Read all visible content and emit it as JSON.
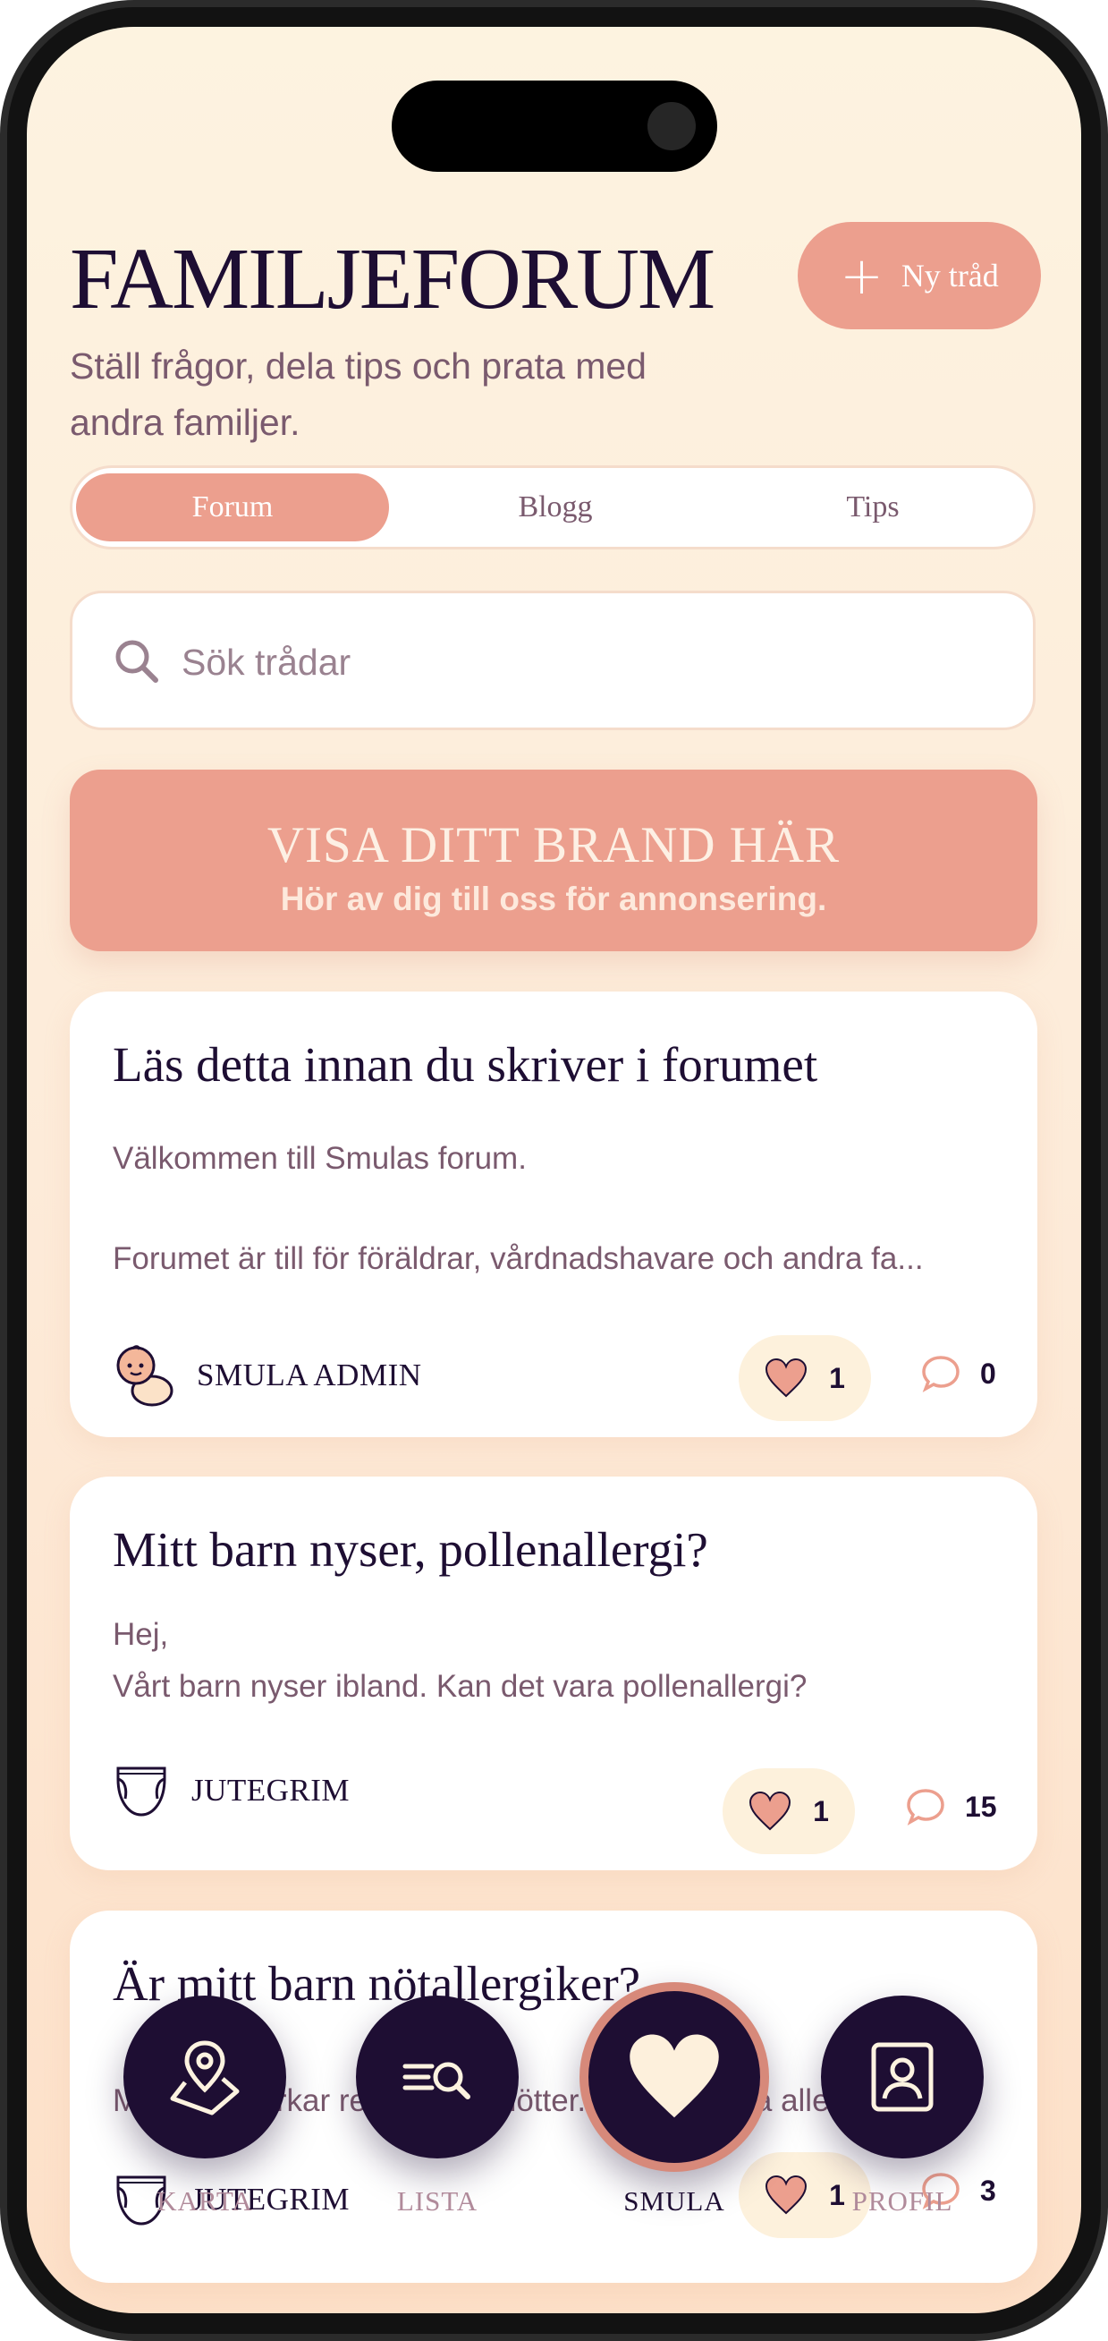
{
  "header": {
    "title": "FAMILJEFORUM",
    "subtitle": "Ställ frågor, dela tips och prata med andra familjer.",
    "new_thread_label": "Ny tråd"
  },
  "tabs": [
    {
      "label": "Forum",
      "active": true
    },
    {
      "label": "Blogg",
      "active": false
    },
    {
      "label": "Tips",
      "active": false
    }
  ],
  "search": {
    "placeholder": "Sök trådar"
  },
  "ad": {
    "title": "VISA DITT BRAND HÄR",
    "subtitle": "Hör av dig till oss för annonsering."
  },
  "threads": [
    {
      "title": "Läs detta innan du skriver i forumet",
      "body_line1": "Välkommen till Smulas forum.",
      "body_line2": "Forumet är till för föräldrar, vårdnadshavare och andra fa...",
      "author": "SMULA ADMIN",
      "avatar": "baby-icon",
      "likes": "1",
      "comments": "0"
    },
    {
      "title": "Mitt barn nyser, pollenallergi?",
      "body_line1": "Hej,",
      "body_line2": "Vårt barn nyser ibland. Kan det vara pollenallergi?",
      "author": "JUTEGRIM",
      "avatar": "diaper-icon",
      "likes": "1",
      "comments": "15"
    },
    {
      "title": "Är mitt barn nötallergiker?",
      "body_line1": "Mitt barn verkar reagera på nötter. Kan det vara allergisk?",
      "author": "JUTEGRIM",
      "avatar": "diaper-icon",
      "likes": "1",
      "comments": "3"
    }
  ],
  "nav": [
    {
      "label": "KARTA",
      "icon": "map-pin-icon"
    },
    {
      "label": "LISTA",
      "icon": "list-search-icon"
    },
    {
      "label": "SMULA",
      "icon": "heart-icon",
      "active": true
    },
    {
      "label": "PROFIL",
      "icon": "profile-icon"
    }
  ],
  "colors": {
    "accent": "#ec9f8e",
    "dark": "#1e0e33",
    "muted": "#7a5a6e",
    "background": "#fdf3e0",
    "pill": "#fdf1dc"
  }
}
